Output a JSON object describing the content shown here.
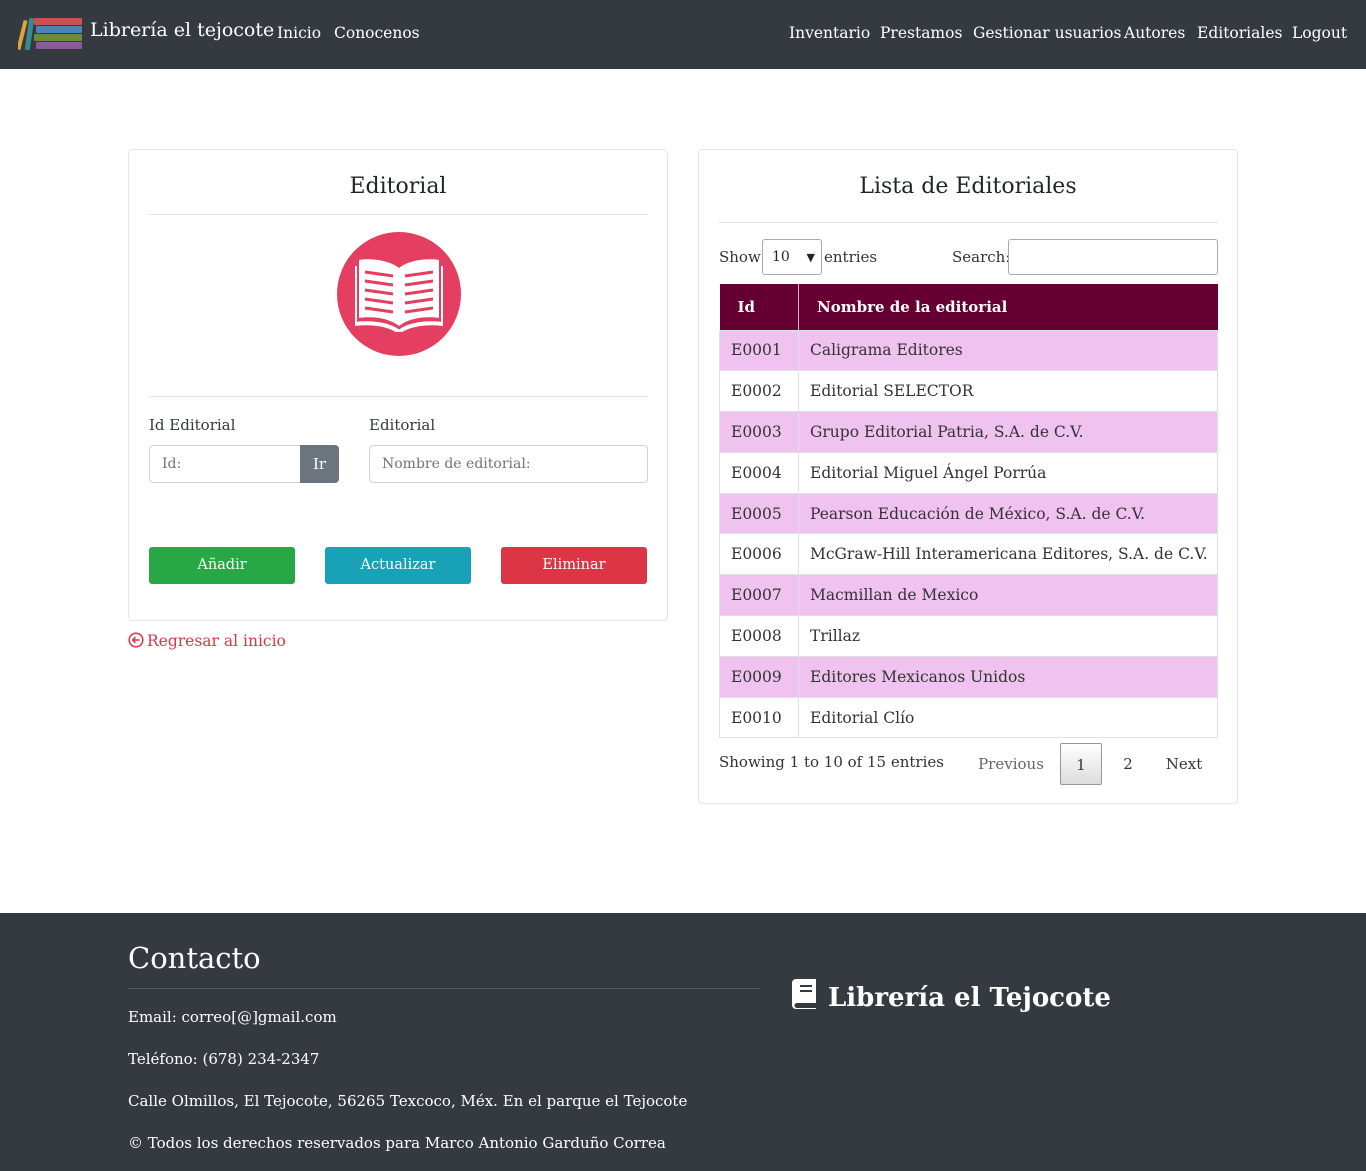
{
  "navbar": {
    "brand": "Librería el tejocote",
    "left_links": [
      "Inicio",
      "Conocenos"
    ],
    "right_links": [
      "Inventario",
      "Prestamos",
      "Gestionar usuarios",
      "Autores",
      "Editoriales",
      "Logout"
    ]
  },
  "form_card": {
    "title": "Editorial",
    "icon": "open-book-icon",
    "id_label": "Id Editorial",
    "id_placeholder": "Id:",
    "go_label": "Ir",
    "name_label": "Editorial",
    "name_placeholder": "Nombre de editorial:",
    "add_label": "Añadir",
    "update_label": "Actualizar",
    "delete_label": "Eliminar"
  },
  "back_link": "Regresar al inicio",
  "list_card": {
    "title": "Lista de Editoriales",
    "show_label": "Show",
    "entries_value": "10",
    "entries_label": "entries",
    "search_label": "Search:",
    "columns": [
      "Id",
      "Nombre de la editorial"
    ],
    "rows": [
      {
        "id": "E0001",
        "name": "Caligrama Editores"
      },
      {
        "id": "E0002",
        "name": "Editorial SELECTOR"
      },
      {
        "id": "E0003",
        "name": "Grupo Editorial Patria, S.A. de C.V."
      },
      {
        "id": "E0004",
        "name": "Editorial Miguel Ángel Porrúa"
      },
      {
        "id": "E0005",
        "name": "Pearson Educación de México, S.A. de C.V."
      },
      {
        "id": "E0006",
        "name": "McGraw-Hill Interamericana Editores, S.A. de C.V."
      },
      {
        "id": "E0007",
        "name": "Macmillan de Mexico"
      },
      {
        "id": "E0008",
        "name": "Trillaz"
      },
      {
        "id": "E0009",
        "name": "Editores Mexicanos Unidos"
      },
      {
        "id": "E0010",
        "name": "Editorial Clío"
      }
    ],
    "info": "Showing 1 to 10 of 15 entries",
    "pagination": {
      "previous": "Previous",
      "pages": [
        "1",
        "2"
      ],
      "next": "Next"
    }
  },
  "footer": {
    "title": "Contacto",
    "email": "Email: correo[@]gmail.com",
    "phone": "Teléfono: (678) 234-2347",
    "address": "Calle Olmillos, El Tejocote, 56265 Texcoco, Méx. En el parque el Tejocote",
    "copyright": "© Todos los derechos reservados para Marco Antonio Garduño Correa",
    "brand": "Librería el Tejocote"
  },
  "colors": {
    "navbar": "#343a40",
    "table_header": "#660033",
    "row_highlight": "#f0c2f0",
    "add": "#28a745",
    "update": "#17a2b8",
    "delete": "#dc3545",
    "icon_circle": "#e43f61"
  }
}
